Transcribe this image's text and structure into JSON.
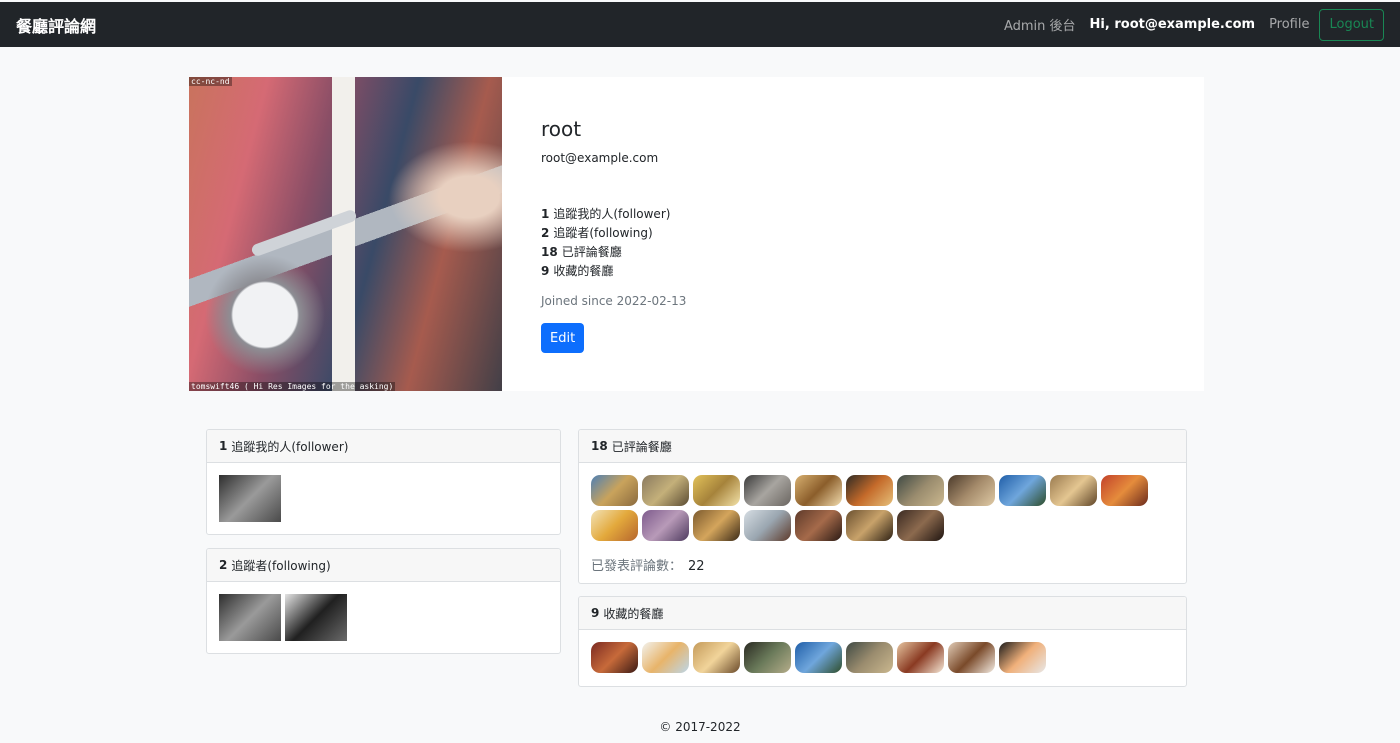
{
  "nav": {
    "brand": "餐廳評論網",
    "admin_label": "Admin 後台",
    "greeting": "Hi, root@example.com",
    "profile_label": "Profile",
    "logout_label": "Logout"
  },
  "avatar": {
    "license_tag": "cc-nc-nd",
    "credit_text": "tomswift46 ( Hi Res Images for the asking)"
  },
  "profile": {
    "name": "root",
    "email": "root@example.com",
    "stats": [
      {
        "count": "1",
        "label": "追蹤我的人(follower)"
      },
      {
        "count": "2",
        "label": "追蹤者(following)"
      },
      {
        "count": "18",
        "label": "已評論餐廳"
      },
      {
        "count": "9",
        "label": "收藏的餐廳"
      }
    ],
    "joined": "Joined since 2022-02-13",
    "edit_label": "Edit"
  },
  "followers_card": {
    "count": "1",
    "title": "追蹤我的人(follower)",
    "thumbs": [
      {
        "colors": [
          "#2e2e2e",
          "#9a9a9a",
          "#4a4a4a"
        ]
      }
    ]
  },
  "following_card": {
    "count": "2",
    "title": "追蹤者(following)",
    "thumbs": [
      {
        "colors": [
          "#2e2e2e",
          "#9a9a9a",
          "#4a4a4a"
        ]
      },
      {
        "colors": [
          "#e4e4e4",
          "#202020",
          "#6a6a6a"
        ]
      }
    ]
  },
  "reviewed_card": {
    "count": "18",
    "title": "已評論餐廳",
    "thumbs": [
      {
        "colors": [
          "#4d7fb5",
          "#c9a35c",
          "#8a6a3e"
        ]
      },
      {
        "colors": [
          "#8a7a5f",
          "#c4b07a",
          "#5b4c33"
        ]
      },
      {
        "colors": [
          "#e2c25a",
          "#a6833b",
          "#f3e2a9"
        ]
      },
      {
        "colors": [
          "#3a3a3a",
          "#a8a5a0",
          "#6a6560"
        ]
      },
      {
        "colors": [
          "#d8b070",
          "#8b5e2b",
          "#f2dcae"
        ]
      },
      {
        "colors": [
          "#2d2a24",
          "#c46a2a",
          "#e6c07a"
        ]
      },
      {
        "colors": [
          "#3f4a44",
          "#9a8c6e",
          "#cbb88f"
        ]
      },
      {
        "colors": [
          "#4b3a2b",
          "#a58b6b",
          "#dfcaa5"
        ]
      },
      {
        "colors": [
          "#1f5ea8",
          "#6fa6dc",
          "#2e4d2a"
        ]
      },
      {
        "colors": [
          "#9a7a4f",
          "#e4c691",
          "#5e4427"
        ]
      },
      {
        "colors": [
          "#c2412a",
          "#e58c3c",
          "#6b2a1c"
        ]
      },
      {
        "colors": [
          "#f2e2b6",
          "#e3a93c",
          "#b5652d"
        ]
      },
      {
        "colors": [
          "#7d5a8c",
          "#b89ab8",
          "#4d3a5e"
        ]
      },
      {
        "colors": [
          "#7b5a2e",
          "#d4a55c",
          "#3b2a17"
        ]
      },
      {
        "colors": [
          "#d6dde3",
          "#9aa6b0",
          "#5d3a2a"
        ]
      },
      {
        "colors": [
          "#5e3a2a",
          "#a56a4a",
          "#2a1a14"
        ]
      },
      {
        "colors": [
          "#6a5030",
          "#c8a26a",
          "#2d2014"
        ]
      },
      {
        "colors": [
          "#3a2a22",
          "#8c6a4e",
          "#1e1410"
        ]
      }
    ],
    "comment_label": "已發表評論數：",
    "comment_count": "22"
  },
  "favorites_card": {
    "count": "9",
    "title": "收藏的餐廳",
    "thumbs": [
      {
        "colors": [
          "#7a2a22",
          "#c76a3a",
          "#3a1a14"
        ]
      },
      {
        "colors": [
          "#f2f2ee",
          "#e8b46a",
          "#bcd6e8"
        ]
      },
      {
        "colors": [
          "#c49a5a",
          "#f1d49a",
          "#6a4a2a"
        ]
      },
      {
        "colors": [
          "#2a2a22",
          "#6a7a5a",
          "#b5ad8a"
        ]
      },
      {
        "colors": [
          "#1f5ea8",
          "#6fa6dc",
          "#2e4d2a"
        ]
      },
      {
        "colors": [
          "#3f4a44",
          "#9a8c6e",
          "#cbb88f"
        ]
      },
      {
        "colors": [
          "#e6c5a0",
          "#8a3a22",
          "#f6e8d6"
        ]
      },
      {
        "colors": [
          "#e2cdb8",
          "#7a4a2a",
          "#f4ece2"
        ]
      },
      {
        "colors": [
          "#1a1a1a",
          "#f0b07a",
          "#e8e8e8"
        ]
      }
    ]
  },
  "footer": {
    "text": "© 2017-2022"
  }
}
